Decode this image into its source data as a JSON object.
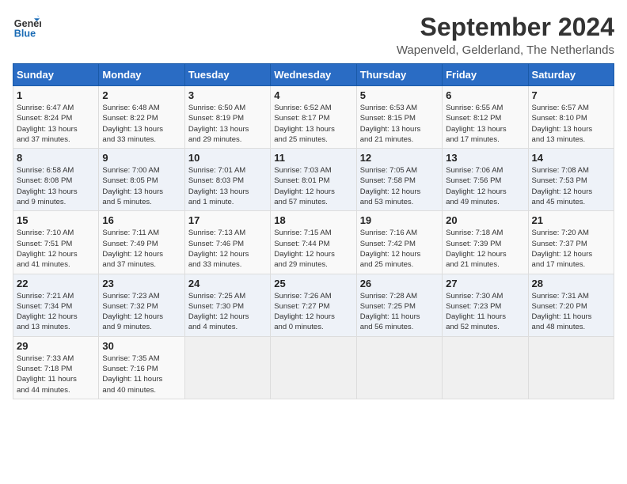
{
  "logo": {
    "line1": "General",
    "line2": "Blue"
  },
  "title": "September 2024",
  "location": "Wapenveld, Gelderland, The Netherlands",
  "days_of_week": [
    "Sunday",
    "Monday",
    "Tuesday",
    "Wednesday",
    "Thursday",
    "Friday",
    "Saturday"
  ],
  "weeks": [
    [
      {
        "day": "1",
        "info": "Sunrise: 6:47 AM\nSunset: 8:24 PM\nDaylight: 13 hours\nand 37 minutes."
      },
      {
        "day": "2",
        "info": "Sunrise: 6:48 AM\nSunset: 8:22 PM\nDaylight: 13 hours\nand 33 minutes."
      },
      {
        "day": "3",
        "info": "Sunrise: 6:50 AM\nSunset: 8:19 PM\nDaylight: 13 hours\nand 29 minutes."
      },
      {
        "day": "4",
        "info": "Sunrise: 6:52 AM\nSunset: 8:17 PM\nDaylight: 13 hours\nand 25 minutes."
      },
      {
        "day": "5",
        "info": "Sunrise: 6:53 AM\nSunset: 8:15 PM\nDaylight: 13 hours\nand 21 minutes."
      },
      {
        "day": "6",
        "info": "Sunrise: 6:55 AM\nSunset: 8:12 PM\nDaylight: 13 hours\nand 17 minutes."
      },
      {
        "day": "7",
        "info": "Sunrise: 6:57 AM\nSunset: 8:10 PM\nDaylight: 13 hours\nand 13 minutes."
      }
    ],
    [
      {
        "day": "8",
        "info": "Sunrise: 6:58 AM\nSunset: 8:08 PM\nDaylight: 13 hours\nand 9 minutes."
      },
      {
        "day": "9",
        "info": "Sunrise: 7:00 AM\nSunset: 8:05 PM\nDaylight: 13 hours\nand 5 minutes."
      },
      {
        "day": "10",
        "info": "Sunrise: 7:01 AM\nSunset: 8:03 PM\nDaylight: 13 hours\nand 1 minute."
      },
      {
        "day": "11",
        "info": "Sunrise: 7:03 AM\nSunset: 8:01 PM\nDaylight: 12 hours\nand 57 minutes."
      },
      {
        "day": "12",
        "info": "Sunrise: 7:05 AM\nSunset: 7:58 PM\nDaylight: 12 hours\nand 53 minutes."
      },
      {
        "day": "13",
        "info": "Sunrise: 7:06 AM\nSunset: 7:56 PM\nDaylight: 12 hours\nand 49 minutes."
      },
      {
        "day": "14",
        "info": "Sunrise: 7:08 AM\nSunset: 7:53 PM\nDaylight: 12 hours\nand 45 minutes."
      }
    ],
    [
      {
        "day": "15",
        "info": "Sunrise: 7:10 AM\nSunset: 7:51 PM\nDaylight: 12 hours\nand 41 minutes."
      },
      {
        "day": "16",
        "info": "Sunrise: 7:11 AM\nSunset: 7:49 PM\nDaylight: 12 hours\nand 37 minutes."
      },
      {
        "day": "17",
        "info": "Sunrise: 7:13 AM\nSunset: 7:46 PM\nDaylight: 12 hours\nand 33 minutes."
      },
      {
        "day": "18",
        "info": "Sunrise: 7:15 AM\nSunset: 7:44 PM\nDaylight: 12 hours\nand 29 minutes."
      },
      {
        "day": "19",
        "info": "Sunrise: 7:16 AM\nSunset: 7:42 PM\nDaylight: 12 hours\nand 25 minutes."
      },
      {
        "day": "20",
        "info": "Sunrise: 7:18 AM\nSunset: 7:39 PM\nDaylight: 12 hours\nand 21 minutes."
      },
      {
        "day": "21",
        "info": "Sunrise: 7:20 AM\nSunset: 7:37 PM\nDaylight: 12 hours\nand 17 minutes."
      }
    ],
    [
      {
        "day": "22",
        "info": "Sunrise: 7:21 AM\nSunset: 7:34 PM\nDaylight: 12 hours\nand 13 minutes."
      },
      {
        "day": "23",
        "info": "Sunrise: 7:23 AM\nSunset: 7:32 PM\nDaylight: 12 hours\nand 9 minutes."
      },
      {
        "day": "24",
        "info": "Sunrise: 7:25 AM\nSunset: 7:30 PM\nDaylight: 12 hours\nand 4 minutes."
      },
      {
        "day": "25",
        "info": "Sunrise: 7:26 AM\nSunset: 7:27 PM\nDaylight: 12 hours\nand 0 minutes."
      },
      {
        "day": "26",
        "info": "Sunrise: 7:28 AM\nSunset: 7:25 PM\nDaylight: 11 hours\nand 56 minutes."
      },
      {
        "day": "27",
        "info": "Sunrise: 7:30 AM\nSunset: 7:23 PM\nDaylight: 11 hours\nand 52 minutes."
      },
      {
        "day": "28",
        "info": "Sunrise: 7:31 AM\nSunset: 7:20 PM\nDaylight: 11 hours\nand 48 minutes."
      }
    ],
    [
      {
        "day": "29",
        "info": "Sunrise: 7:33 AM\nSunset: 7:18 PM\nDaylight: 11 hours\nand 44 minutes."
      },
      {
        "day": "30",
        "info": "Sunrise: 7:35 AM\nSunset: 7:16 PM\nDaylight: 11 hours\nand 40 minutes."
      },
      null,
      null,
      null,
      null,
      null
    ]
  ]
}
